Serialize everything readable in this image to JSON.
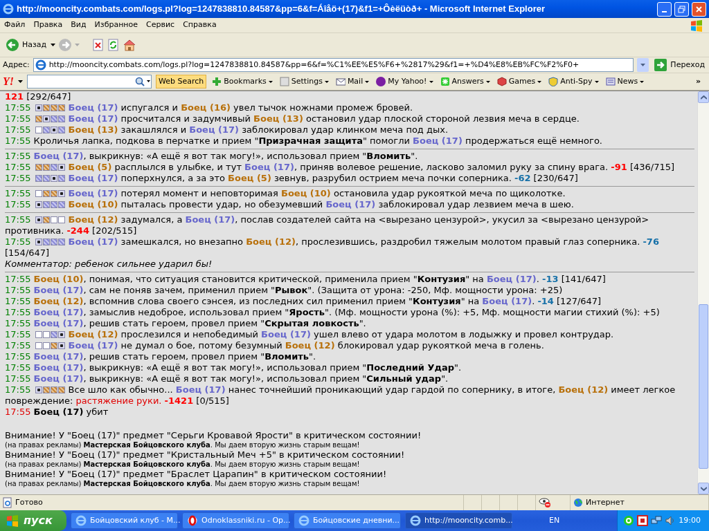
{
  "window": {
    "title": "http://mooncity.combats.com/logs.pl?log=1247838810.84587&pp=6&f=Áîåö+(17)&f1=+Ôèëüòð+ - Microsoft Internet Explorer"
  },
  "menu": [
    "Файл",
    "Правка",
    "Вид",
    "Избранное",
    "Сервис",
    "Справка"
  ],
  "toolbar": {
    "back": "Назад"
  },
  "address": {
    "label": "Адрес:",
    "url": "http://mooncity.combats.com/logs.pl?log=1247838810.84587&pp=6&f=%C1%EE%E5%F6+%2817%29&f1=+%D4%E8%EB%FC%F2%F0+",
    "go": "Переход"
  },
  "yahoo_toolbar": {
    "logo": "Y!",
    "search_button": "Web Search",
    "items": [
      "Bookmarks",
      "Settings",
      "Mail",
      "My Yahoo!",
      "Answers",
      "Games",
      "Anti-Spy",
      "News"
    ],
    "more": "»"
  },
  "log": [
    [
      {
        "kind": "entry",
        "parts": [
          {
            "kind": "damage",
            "text": "121"
          },
          {
            "kind": "text",
            "text": " [292/647]"
          }
        ]
      },
      {
        "kind": "entry",
        "time": "17:55",
        "death": false,
        "zones": [
          {
            "kind": "hit"
          },
          {
            "kind": "orange"
          },
          {
            "kind": "orange"
          },
          {
            "kind": "orange"
          }
        ],
        "parts": [
          {
            "kind": "fighter_blue",
            "text": "Боец (17)"
          },
          {
            "kind": "text",
            "text": " испугался и "
          },
          {
            "kind": "fighter_orange",
            "text": "Боец (16)"
          },
          {
            "kind": "text",
            "text": " увел тычок ножнами промеж бровей."
          }
        ]
      },
      {
        "kind": "entry",
        "time": "17:55",
        "death": false,
        "zones": [
          {
            "kind": "orange"
          },
          {
            "kind": "hit"
          },
          {
            "kind": "blue"
          },
          {
            "kind": "blue"
          }
        ],
        "parts": [
          {
            "kind": "fighter_blue",
            "text": "Боец (17)"
          },
          {
            "kind": "text",
            "text": " просчитался и задумчивый "
          },
          {
            "kind": "fighter_orange",
            "text": "Боец (13)"
          },
          {
            "kind": "text",
            "text": " остановил удар плоской стороной лезвия меча в сердце."
          }
        ]
      },
      {
        "kind": "entry",
        "time": "17:55",
        "death": false,
        "zones": [
          {
            "kind": "empty"
          },
          {
            "kind": "blue"
          },
          {
            "kind": "hit"
          },
          {
            "kind": "blue"
          }
        ],
        "parts": [
          {
            "kind": "fighter_orange",
            "text": "Боец (13)"
          },
          {
            "kind": "text",
            "text": " закашлялся и "
          },
          {
            "kind": "fighter_blue",
            "text": "Боец (17)"
          },
          {
            "kind": "text",
            "text": " заблокировал удар клинком меча под дых."
          }
        ]
      },
      {
        "kind": "entry",
        "time": "17:55",
        "death": false,
        "parts": [
          {
            "kind": "text",
            "text": "Кроличья лапка, подкова в перчатке и прием \""
          },
          {
            "kind": "bold",
            "text": "Призрачная защита"
          },
          {
            "kind": "text",
            "text": "\" помогли "
          },
          {
            "kind": "fighter_blue",
            "text": "Боец (17)"
          },
          {
            "kind": "text",
            "text": " продержаться ещё немного."
          }
        ]
      }
    ],
    [
      {
        "kind": "entry",
        "time": "17:55",
        "death": false,
        "parts": [
          {
            "kind": "fighter_blue",
            "text": "Боец (17)"
          },
          {
            "kind": "text",
            "text": ", выкрикнув: «А ещё я вот так могу!», использовал прием \""
          },
          {
            "kind": "bold",
            "text": "Вломить"
          },
          {
            "kind": "text",
            "text": "\"."
          }
        ]
      },
      {
        "kind": "entry",
        "time": "17:55",
        "death": false,
        "zones": [
          {
            "kind": "orange"
          },
          {
            "kind": "orange"
          },
          {
            "kind": "blue"
          },
          {
            "kind": "hit"
          }
        ],
        "parts": [
          {
            "kind": "fighter_orange",
            "text": "Боец (5)"
          },
          {
            "kind": "text",
            "text": " расплылся в улыбке, и тут "
          },
          {
            "kind": "fighter_blue",
            "text": "Боец (17)"
          },
          {
            "kind": "text",
            "text": ", приняв волевое решение, ласково заломил руку за спину врага. "
          },
          {
            "kind": "damage",
            "text": "-91"
          },
          {
            "kind": "text",
            "text": " [436/715]"
          }
        ]
      },
      {
        "kind": "entry",
        "time": "17:55",
        "death": false,
        "zones": [
          {
            "kind": "blue"
          },
          {
            "kind": "blue"
          },
          {
            "kind": "hit"
          },
          {
            "kind": "blue"
          }
        ],
        "parts": [
          {
            "kind": "fighter_blue",
            "text": "Боец (17)"
          },
          {
            "kind": "text",
            "text": " поперхнулся, а за это "
          },
          {
            "kind": "fighter_orange",
            "text": "Боец (5)"
          },
          {
            "kind": "text",
            "text": " зевнув, разрубил острием меча почки соперника. "
          },
          {
            "kind": "damage_blue",
            "text": "-62"
          },
          {
            "kind": "text",
            "text": " [230/647]"
          }
        ]
      }
    ],
    [
      {
        "kind": "entry",
        "time": "17:55",
        "death": false,
        "zones": [
          {
            "kind": "empty"
          },
          {
            "kind": "orange"
          },
          {
            "kind": "orange"
          },
          {
            "kind": "hit"
          }
        ],
        "parts": [
          {
            "kind": "fighter_blue",
            "text": "Боец (17)"
          },
          {
            "kind": "text",
            "text": " потерял момент и неповторимая "
          },
          {
            "kind": "fighter_orange",
            "text": "Боец (10)"
          },
          {
            "kind": "text",
            "text": " остановила удар рукояткой меча по щиколотке."
          }
        ]
      },
      {
        "kind": "entry",
        "time": "17:55",
        "death": false,
        "zones": [
          {
            "kind": "hit"
          },
          {
            "kind": "blue"
          },
          {
            "kind": "blue"
          },
          {
            "kind": "blue"
          }
        ],
        "parts": [
          {
            "kind": "fighter_orange",
            "text": "Боец (10)"
          },
          {
            "kind": "text",
            "text": " пыталась провести удар, но обезумевший "
          },
          {
            "kind": "fighter_blue",
            "text": "Боец (17)"
          },
          {
            "kind": "text",
            "text": " заблокировал удар лезвием меча в шею."
          }
        ]
      }
    ],
    [
      {
        "kind": "entry",
        "time": "17:55",
        "death": false,
        "zones": [
          {
            "kind": "hit"
          },
          {
            "kind": "orange"
          },
          {
            "kind": "empty"
          },
          {
            "kind": "empty"
          }
        ],
        "parts": [
          {
            "kind": "fighter_orange",
            "text": "Боец (12)"
          },
          {
            "kind": "text",
            "text": " задумался, а "
          },
          {
            "kind": "fighter_blue",
            "text": "Боец (17)"
          },
          {
            "kind": "text",
            "text": ", послав создателей сайта на <вырезано цензурой>, укусил за <вырезано цензурой> противника. "
          },
          {
            "kind": "damage",
            "text": "-244"
          },
          {
            "kind": "text",
            "text": " [202/515]"
          }
        ]
      },
      {
        "kind": "entry",
        "time": "17:55",
        "death": false,
        "zones": [
          {
            "kind": "hit"
          },
          {
            "kind": "blue"
          },
          {
            "kind": "blue"
          },
          {
            "kind": "blue"
          }
        ],
        "parts": [
          {
            "kind": "fighter_blue",
            "text": "Боец (17)"
          },
          {
            "kind": "text",
            "text": " замешкался, но внезапно "
          },
          {
            "kind": "fighter_orange",
            "text": "Боец (12)"
          },
          {
            "kind": "text",
            "text": ", прослезившись, раздробил тяжелым молотом правый глаз соперника. "
          },
          {
            "kind": "damage_blue",
            "text": "-76"
          },
          {
            "kind": "text",
            "text": " [154/647]"
          }
        ]
      },
      {
        "kind": "comment",
        "text": "Комментатор: ребенок сильнее ударил бы!"
      }
    ],
    [
      {
        "kind": "entry",
        "time": "17:55",
        "death": false,
        "parts": [
          {
            "kind": "fighter_orange",
            "text": "Боец (10)"
          },
          {
            "kind": "text",
            "text": ", понимая, что ситуация становится критической, применила прием \""
          },
          {
            "kind": "bold",
            "text": "Контузия"
          },
          {
            "kind": "text",
            "text": "\" на "
          },
          {
            "kind": "fighter_blue",
            "text": "Боец (17)"
          },
          {
            "kind": "text",
            "text": ". "
          },
          {
            "kind": "damage_blue",
            "text": "-13"
          },
          {
            "kind": "text",
            "text": " [141/647]"
          }
        ]
      },
      {
        "kind": "entry",
        "time": "17:55",
        "death": false,
        "parts": [
          {
            "kind": "fighter_blue",
            "text": "Боец (17)"
          },
          {
            "kind": "text",
            "text": ", сам не поняв зачем, применил прием \""
          },
          {
            "kind": "bold",
            "text": "Рывок"
          },
          {
            "kind": "text",
            "text": "\". (Защита от урона: -250, Мф. мощности урона: +25)"
          }
        ]
      },
      {
        "kind": "entry",
        "time": "17:55",
        "death": false,
        "parts": [
          {
            "kind": "fighter_orange",
            "text": "Боец (12)"
          },
          {
            "kind": "text",
            "text": ", вспомнив слова своего сэнсея, из последних сил применил прием \""
          },
          {
            "kind": "bold",
            "text": "Контузия"
          },
          {
            "kind": "text",
            "text": "\" на "
          },
          {
            "kind": "fighter_blue",
            "text": "Боец (17)"
          },
          {
            "kind": "text",
            "text": ". "
          },
          {
            "kind": "damage_blue",
            "text": "-14"
          },
          {
            "kind": "text",
            "text": " [127/647]"
          }
        ]
      },
      {
        "kind": "entry",
        "time": "17:55",
        "death": false,
        "parts": [
          {
            "kind": "fighter_blue",
            "text": "Боец (17)"
          },
          {
            "kind": "text",
            "text": ", замыслив недоброе, использовал прием \""
          },
          {
            "kind": "bold",
            "text": "Ярость"
          },
          {
            "kind": "text",
            "text": "\". (Мф. мощности урона (%): +5, Мф. мощности магии стихий (%): +5)"
          }
        ]
      },
      {
        "kind": "entry",
        "time": "17:55",
        "death": false,
        "parts": [
          {
            "kind": "fighter_blue",
            "text": "Боец (17)"
          },
          {
            "kind": "text",
            "text": ", решив стать героем, провел прием \""
          },
          {
            "kind": "bold",
            "text": "Скрытая ловкость"
          },
          {
            "kind": "text",
            "text": "\"."
          }
        ]
      },
      {
        "kind": "entry",
        "time": "17:55",
        "death": false,
        "zones": [
          {
            "kind": "empty"
          },
          {
            "kind": "empty"
          },
          {
            "kind": "blue"
          },
          {
            "kind": "hit"
          }
        ],
        "parts": [
          {
            "kind": "fighter_orange",
            "text": "Боец (12)"
          },
          {
            "kind": "text",
            "text": " прослезился и непобедимый "
          },
          {
            "kind": "fighter_blue",
            "text": "Боец (17)"
          },
          {
            "kind": "text",
            "text": " ушел влево от удара молотом в лодыжку и провел контрудар."
          }
        ]
      },
      {
        "kind": "entry",
        "time": "17:55",
        "death": false,
        "zones": [
          {
            "kind": "empty"
          },
          {
            "kind": "empty"
          },
          {
            "kind": "orange"
          },
          {
            "kind": "hit"
          }
        ],
        "parts": [
          {
            "kind": "fighter_blue",
            "text": "Боец (17)"
          },
          {
            "kind": "text",
            "text": " не думал о бое, потому безумный "
          },
          {
            "kind": "fighter_orange",
            "text": "Боец (12)"
          },
          {
            "kind": "text",
            "text": " блокировал удар рукояткой меча в голень."
          }
        ]
      },
      {
        "kind": "entry",
        "time": "17:55",
        "death": false,
        "parts": [
          {
            "kind": "fighter_blue",
            "text": "Боец (17)"
          },
          {
            "kind": "text",
            "text": ", решив стать героем, провел прием \""
          },
          {
            "kind": "bold",
            "text": "Вломить"
          },
          {
            "kind": "text",
            "text": "\"."
          }
        ]
      },
      {
        "kind": "entry",
        "time": "17:55",
        "death": false,
        "parts": [
          {
            "kind": "fighter_blue",
            "text": "Боец (17)"
          },
          {
            "kind": "text",
            "text": ", выкрикнув: «А ещё я вот так могу!», использовал прием \""
          },
          {
            "kind": "bold",
            "text": "Последний Удар"
          },
          {
            "kind": "text",
            "text": "\"."
          }
        ]
      },
      {
        "kind": "entry",
        "time": "17:55",
        "death": false,
        "parts": [
          {
            "kind": "fighter_blue",
            "text": "Боец (17)"
          },
          {
            "kind": "text",
            "text": ", выкрикнув: «А ещё я вот так могу!», использовал прием \""
          },
          {
            "kind": "bold",
            "text": "Сильный удар"
          },
          {
            "kind": "text",
            "text": "\"."
          }
        ]
      },
      {
        "kind": "entry",
        "time": "17:55",
        "death": false,
        "zones": [
          {
            "kind": "hit"
          },
          {
            "kind": "orange"
          },
          {
            "kind": "orange"
          },
          {
            "kind": "orange"
          }
        ],
        "parts": [
          {
            "kind": "text",
            "text": "Все шло как обычно... "
          },
          {
            "kind": "fighter_blue",
            "text": "Боец (17)"
          },
          {
            "kind": "text",
            "text": " нанес точнейший проникающий удар гардой по сопернику, в итоге, "
          },
          {
            "kind": "fighter_orange",
            "text": "Боец (12)"
          },
          {
            "kind": "text",
            "text": " имеет легкое повреждение: "
          },
          {
            "kind": "injury",
            "text": "растяжение руки. "
          },
          {
            "kind": "damage",
            "text": "-1421"
          },
          {
            "kind": "text",
            "text": " [0/515]"
          }
        ]
      },
      {
        "kind": "entry",
        "time": "17:55",
        "death": true,
        "parts": [
          {
            "kind": "bold",
            "text": "Боец (17)"
          },
          {
            "kind": "text",
            "text": " убит"
          }
        ]
      }
    ]
  ],
  "notices": [
    {
      "text": "Внимание! У \"Боец (17)\" предмет \"Серьги Кровавой Ярости\" в критическом состоянии!",
      "ad": "(на правах рекламы) **Мастерская Бойцовского клуба**. Мы даем вторую жизнь старым вещам!"
    },
    {
      "text": "Внимание! У \"Боец (17)\" предмет \"Кристальный Меч +5\" в критическом состоянии!",
      "ad": "(на правах рекламы) **Мастерская Бойцовского клуба**. Мы даем вторую жизнь старым вещам!"
    },
    {
      "text": "Внимание! У \"Боец (17)\" предмет \"Браслет Царапин\" в критическом состоянии!",
      "ad": "(на правах рекламы) **Мастерская Бойцовского клуба**. Мы даем вторую жизнь старым вещам!"
    }
  ],
  "status_bar": {
    "text": "Готово",
    "zone": "Интернет"
  },
  "taskbar": {
    "start": "пуск",
    "tasks": [
      {
        "label": "Бойцовский клуб - M...",
        "selected": false
      },
      {
        "label": "Odnoklassniki.ru - Op...",
        "selected": false
      },
      {
        "label": "Бойцовские дневни...",
        "selected": false
      },
      {
        "label": "http://mooncity.comb...",
        "selected": true
      }
    ],
    "language": "EN",
    "clock": "19:00"
  }
}
